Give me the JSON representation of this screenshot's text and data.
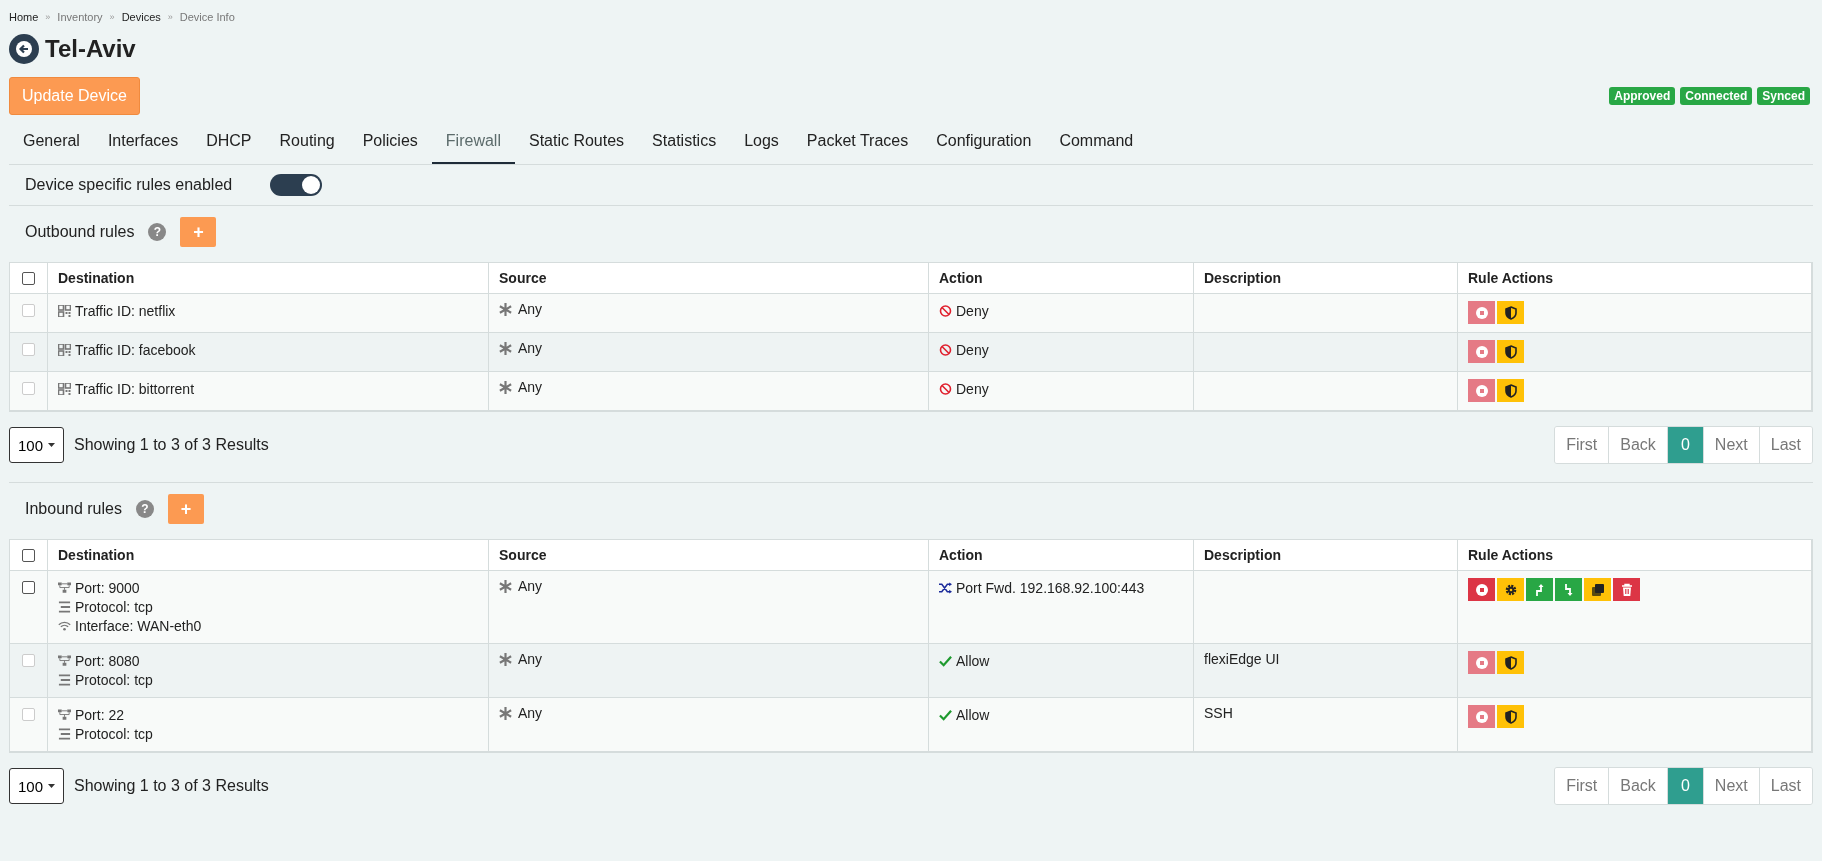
{
  "breadcrumb": {
    "separator": "»",
    "items": [
      {
        "label": "Home",
        "link": true
      },
      {
        "label": "Inventory",
        "link": false
      },
      {
        "label": "Devices",
        "link": true
      },
      {
        "label": "Device Info",
        "link": false
      }
    ]
  },
  "title": "Tel-Aviv",
  "update_button": "Update Device",
  "badges": [
    "Approved",
    "Connected",
    "Synced"
  ],
  "tabs": [
    {
      "label": "General",
      "selected": false
    },
    {
      "label": "Interfaces",
      "selected": false
    },
    {
      "label": "DHCP",
      "selected": false
    },
    {
      "label": "Routing",
      "selected": false
    },
    {
      "label": "Policies",
      "selected": false
    },
    {
      "label": "Firewall",
      "selected": true
    },
    {
      "label": "Static Routes",
      "selected": false
    },
    {
      "label": "Statistics",
      "selected": false
    },
    {
      "label": "Logs",
      "selected": false
    },
    {
      "label": "Packet Traces",
      "selected": false
    },
    {
      "label": "Configuration",
      "selected": false
    },
    {
      "label": "Command",
      "selected": false
    }
  ],
  "device_rules_toggle": {
    "label": "Device specific rules enabled",
    "on": true
  },
  "sections": [
    {
      "title": "Outbound rules",
      "help": "?",
      "add": "+",
      "select_all": {
        "checked": false
      },
      "columns": [
        "Destination",
        "Source",
        "Action",
        "Description",
        "Rule Actions"
      ],
      "rows": [
        {
          "checked": false,
          "disabled": true,
          "destination": [
            {
              "kind": "traffic",
              "text": "Traffic ID: netflix"
            }
          ],
          "source": "Any",
          "action": {
            "kind": "deny",
            "text": "Deny"
          }
        },
        {
          "checked": false,
          "disabled": true,
          "destination": [
            {
              "kind": "traffic",
              "text": "Traffic ID: facebook"
            }
          ],
          "source": "Any",
          "action": {
            "kind": "deny",
            "text": "Deny"
          }
        },
        {
          "checked": false,
          "disabled": true,
          "destination": [
            {
              "kind": "traffic",
              "text": "Traffic ID: bittorrent"
            }
          ],
          "source": "Any",
          "action": {
            "kind": "deny",
            "text": "Deny"
          }
        }
      ],
      "page_size": "100",
      "summary": "Showing 1 to 3 of 3 Results",
      "pagination": [
        {
          "label": "First",
          "selected": false
        },
        {
          "label": "Back",
          "selected": false
        },
        {
          "label": "0",
          "selected": true
        },
        {
          "label": "Next",
          "selected": false
        },
        {
          "label": "Last",
          "selected": false
        }
      ]
    },
    {
      "title": "Inbound rules",
      "help": "?",
      "add": "+",
      "select_all": {
        "checked": false
      },
      "columns": [
        "Destination",
        "Source",
        "Action",
        "Description",
        "Rule Actions"
      ],
      "rows": [
        {
          "checked": false,
          "disabled": false,
          "destination": [
            {
              "kind": "port",
              "text": "Port: 9000"
            },
            {
              "kind": "protocol",
              "text": "Protocol: tcp"
            },
            {
              "kind": "interface",
              "text": "Interface: WAN-eth0"
            }
          ],
          "source": "Any",
          "action": {
            "kind": "forward",
            "text": "Port Fwd. 192.168.92.100:443"
          }
        },
        {
          "checked": false,
          "disabled": true,
          "destination": [
            {
              "kind": "port",
              "text": "Port: 8080"
            },
            {
              "kind": "protocol",
              "text": "Protocol: tcp"
            }
          ],
          "source": "Any",
          "action": {
            "kind": "allow",
            "text": "Allow"
          },
          "description": "flexiEdge UI"
        },
        {
          "checked": false,
          "disabled": true,
          "destination": [
            {
              "kind": "port",
              "text": "Port: 22"
            },
            {
              "kind": "protocol",
              "text": "Protocol: tcp"
            }
          ],
          "source": "Any",
          "action": {
            "kind": "allow",
            "text": "Allow"
          },
          "description": "SSH"
        }
      ],
      "page_size": "100",
      "summary": "Showing 1 to 3 of 3 Results",
      "pagination": [
        {
          "label": "First",
          "selected": false
        },
        {
          "label": "Back",
          "selected": false
        },
        {
          "label": "0",
          "selected": true
        },
        {
          "label": "Next",
          "selected": false
        },
        {
          "label": "Last",
          "selected": false
        }
      ]
    }
  ]
}
